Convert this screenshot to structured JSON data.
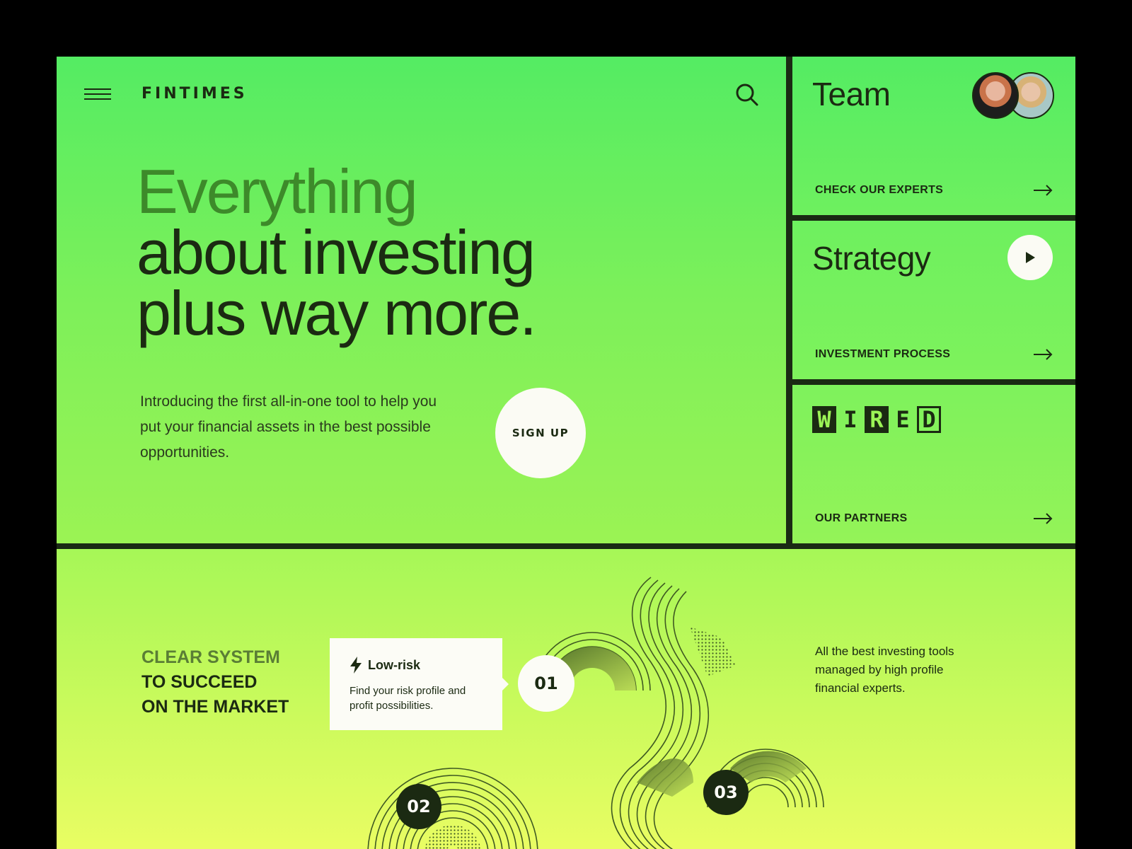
{
  "header": {
    "logo": "FINTIMES",
    "menu_icon": "hamburger-menu-icon",
    "search_icon": "search-icon"
  },
  "hero": {
    "headline_highlight": "Everything",
    "headline_rest_1": "about investing",
    "headline_rest_2": "plus way more.",
    "intro": "Introducing the first all-in-one tool to help you put your financial assets in the best possible opportunities.",
    "signup_label": "SIGN UP"
  },
  "cards": {
    "team": {
      "title": "Team",
      "link": "CHECK OUR EXPERTS"
    },
    "strategy": {
      "title": "Strategy",
      "link": "INVESTMENT PROCESS",
      "play_icon": "play-icon"
    },
    "partners": {
      "logo_letters": [
        "W",
        "I",
        "R",
        "E",
        "D"
      ],
      "link": "OUR PARTNERS"
    }
  },
  "system": {
    "highlight": "CLEAR SYSTEM",
    "rest_1": "TO SUCCEED",
    "rest_2": "ON THE MARKET",
    "tooltip_title": "Low-risk",
    "tooltip_icon": "lightning-icon",
    "tooltip_text": "Find your risk profile and profit possibilities.",
    "steps": [
      "01",
      "02",
      "03"
    ],
    "side_text": "All the best investing tools managed by high profile financial experts."
  },
  "colors": {
    "dark": "#1b2a12",
    "green_top": "#54ec63",
    "highlight_green": "#3d8a2a",
    "lime_bottom": "#e9fd63",
    "cream": "#fbfbf4"
  }
}
